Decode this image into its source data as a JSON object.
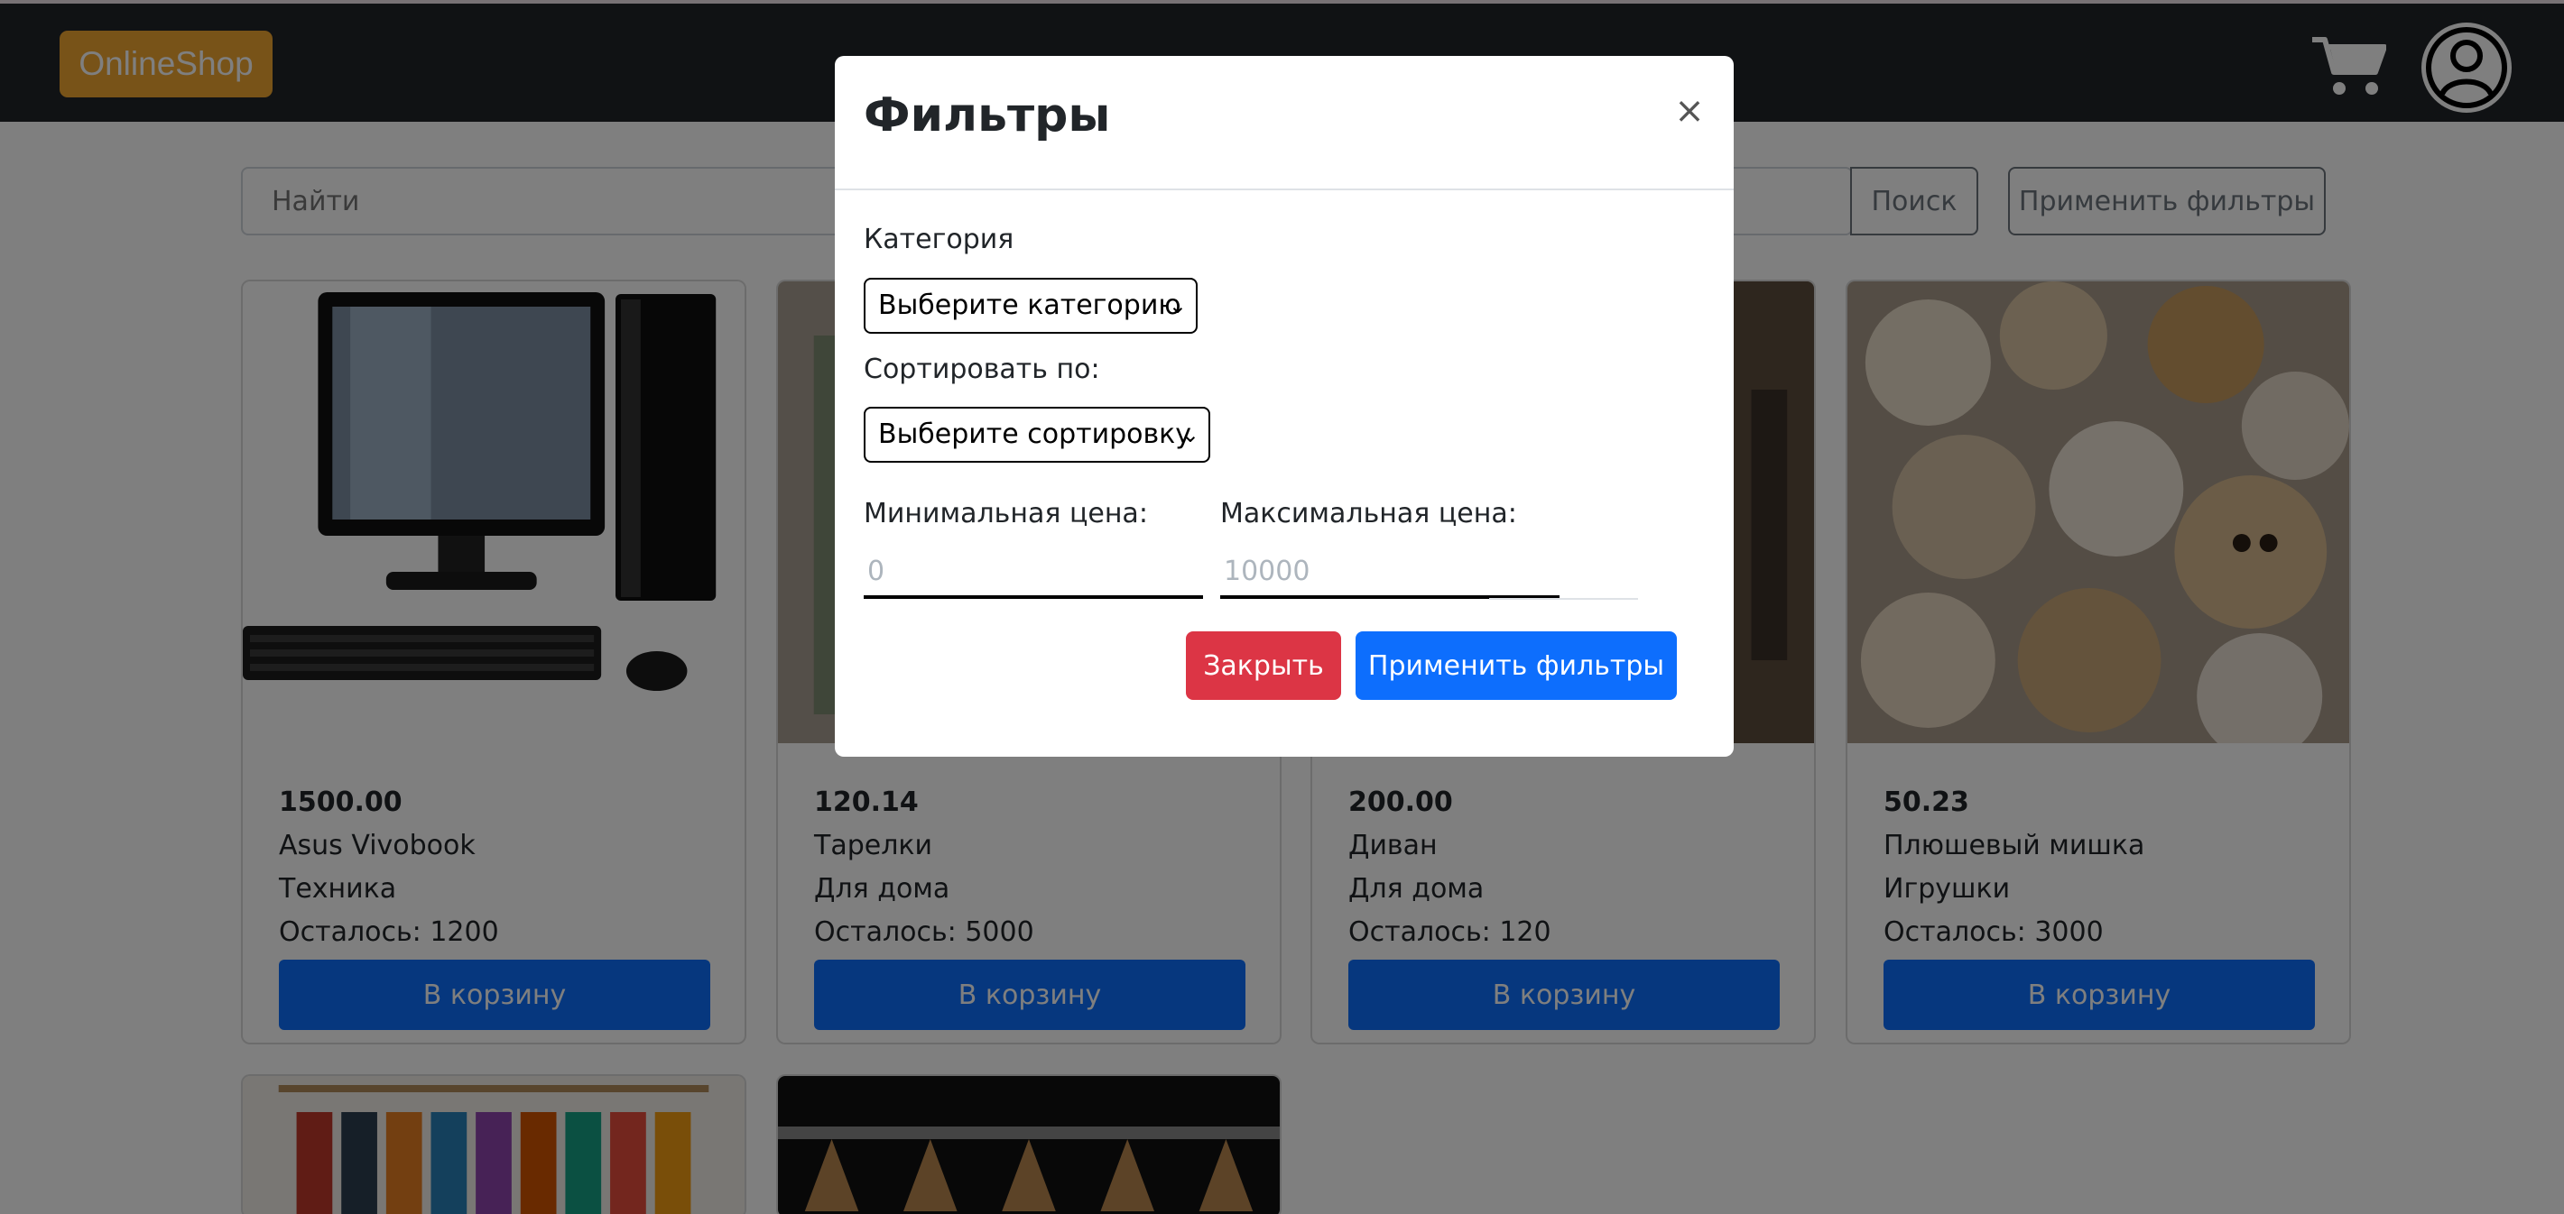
{
  "navbar": {
    "brand": "OnlineShop",
    "cart_icon": "cart-icon",
    "user_icon": "user-circle-icon"
  },
  "search": {
    "placeholder": "Найти",
    "search_button": "Поиск",
    "apply_filters_button": "Применить фильтры"
  },
  "products": [
    {
      "price": "1500.00",
      "name": "Asus Vivobook",
      "category": "Техника",
      "stock": "Осталось: 1200",
      "button": "В корзину"
    },
    {
      "price": "120.14",
      "name": "Тарелки",
      "category": "Для дома",
      "stock": "Осталось: 5000",
      "button": "В корзину"
    },
    {
      "price": "200.00",
      "name": "Диван",
      "category": "Для дома",
      "stock": "Осталось: 120",
      "button": "В корзину"
    },
    {
      "price": "50.23",
      "name": "Плюшевый мишка",
      "category": "Игрушки",
      "stock": "Осталось: 3000",
      "button": "В корзину"
    }
  ],
  "modal": {
    "title": "Фильтры",
    "close_symbol": "×",
    "category_label": "Категория",
    "category_select": "Выберите категорию",
    "sort_label": "Сортировать по:",
    "sort_select": "Выберите сортировку",
    "min_price_label": "Минимальная цена:",
    "min_price_placeholder": "0",
    "max_price_label": "Максимальная цена:",
    "max_price_placeholder": "10000",
    "close_button": "Закрыть",
    "apply_button": "Применить фильтры"
  },
  "colors": {
    "navbar": "#212529",
    "brand": "#f0a631",
    "primary": "#0d6efd",
    "danger": "#dc3545"
  }
}
